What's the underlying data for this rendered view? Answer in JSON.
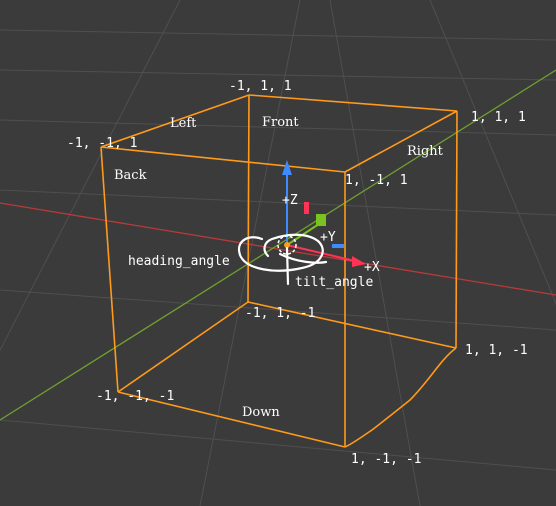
{
  "viewport": {
    "background": "#3b3b3b",
    "grid_color": "#505050",
    "x_axis_color": "#b83a3a",
    "y_axis_color": "#6fa12e"
  },
  "cube": {
    "edge_color": "#ff9a1a",
    "vertices": {
      "top_back_left": "-1, 1, 1",
      "top_back_right": "1, 1, 1",
      "top_front_left": "-1, -1, 1",
      "top_front_right": "1, -1, 1",
      "bottom_back_left": "-1, 1, -1",
      "bottom_back_right": "1, 1, -1",
      "bottom_front_left": "-1, -1, -1",
      "bottom_front_right": "1, -1, -1"
    },
    "faces": {
      "left": "Left",
      "front": "Front",
      "right": "Right",
      "back": "Back",
      "down": "Down"
    }
  },
  "gizmo": {
    "z_label": "+Z",
    "y_label": "+Y",
    "x_label": "+X",
    "z_color": "#3d8bff",
    "y_color": "#7ac21f",
    "x_color": "#ff3355"
  },
  "annotations": {
    "heading": "heading_angle",
    "tilt": "tilt_angle"
  }
}
